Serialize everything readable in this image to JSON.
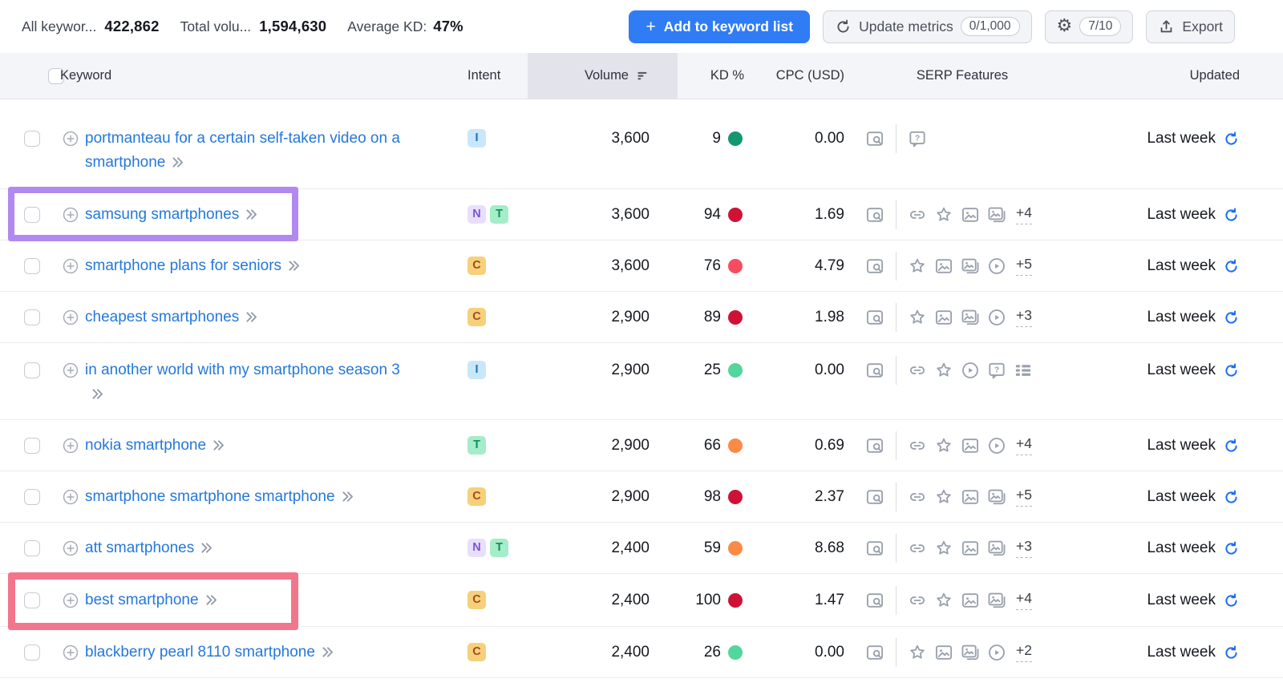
{
  "toolbar": {
    "stats": [
      {
        "label": "All keywor...",
        "value": "422,862"
      },
      {
        "label": "Total volu...",
        "value": "1,594,630"
      },
      {
        "label": "Average KD:",
        "value": "47%"
      }
    ],
    "add_button_plus": "+",
    "add_button_label": "Add to keyword list",
    "update_metrics_label": "Update metrics",
    "update_metrics_quota": "0/1,000",
    "settings_gear_glyph": "⚙",
    "settings_quota": "7/10",
    "export_label": "Export"
  },
  "table": {
    "headers": {
      "keyword": "Keyword",
      "intent": "Intent",
      "volume": "Volume",
      "kd": "KD %",
      "cpc": "CPC (USD)",
      "serp": "SERP Features",
      "updated": "Updated"
    },
    "rows": [
      {
        "keyword": "portmanteau for a certain self-taken video on a smartphone",
        "intents": [
          "I"
        ],
        "volume": "3,600",
        "kd": "9",
        "kd_color": "#13976F",
        "cpc": "0.00",
        "serp_features": [
          "faq"
        ],
        "serp_more": "",
        "updated": "Last week"
      },
      {
        "keyword": "samsung smartphones",
        "intents": [
          "N",
          "T"
        ],
        "volume": "3,600",
        "kd": "94",
        "kd_color": "#CE1236",
        "cpc": "1.69",
        "serp_features": [
          "link",
          "star",
          "image",
          "image-stack"
        ],
        "serp_more": "+4",
        "updated": "Last week"
      },
      {
        "keyword": "smartphone plans for seniors",
        "intents": [
          "C"
        ],
        "volume": "3,600",
        "kd": "76",
        "kd_color": "#F94B5F",
        "cpc": "4.79",
        "serp_features": [
          "star",
          "image",
          "image-stack",
          "video"
        ],
        "serp_more": "+5",
        "updated": "Last week"
      },
      {
        "keyword": "cheapest smartphones",
        "intents": [
          "C"
        ],
        "volume": "2,900",
        "kd": "89",
        "kd_color": "#CE1236",
        "cpc": "1.98",
        "serp_features": [
          "star",
          "image",
          "image-stack",
          "video"
        ],
        "serp_more": "+3",
        "updated": "Last week"
      },
      {
        "keyword": "in another world with my smartphone season 3",
        "intents": [
          "I"
        ],
        "volume": "2,900",
        "kd": "25",
        "kd_color": "#52D69B",
        "cpc": "0.00",
        "serp_features": [
          "link",
          "star",
          "video",
          "faq",
          "list"
        ],
        "serp_more": "",
        "updated": "Last week"
      },
      {
        "keyword": "nokia smartphone",
        "intents": [
          "T"
        ],
        "volume": "2,900",
        "kd": "66",
        "kd_color": "#FB8A46",
        "cpc": "0.69",
        "serp_features": [
          "link",
          "star",
          "image",
          "video"
        ],
        "serp_more": "+4",
        "updated": "Last week"
      },
      {
        "keyword": "smartphone smartphone smartphone",
        "intents": [
          "C"
        ],
        "volume": "2,900",
        "kd": "98",
        "kd_color": "#CE1236",
        "cpc": "2.37",
        "serp_features": [
          "link",
          "star",
          "image",
          "image-stack"
        ],
        "serp_more": "+5",
        "updated": "Last week"
      },
      {
        "keyword": "att smartphones",
        "intents": [
          "N",
          "T"
        ],
        "volume": "2,400",
        "kd": "59",
        "kd_color": "#FB8A46",
        "cpc": "8.68",
        "serp_features": [
          "link",
          "star",
          "image",
          "image-stack"
        ],
        "serp_more": "+3",
        "updated": "Last week"
      },
      {
        "keyword": "best smartphone",
        "intents": [
          "C"
        ],
        "volume": "2,400",
        "kd": "100",
        "kd_color": "#CE1236",
        "cpc": "1.47",
        "serp_features": [
          "link",
          "star",
          "image",
          "image-stack"
        ],
        "serp_more": "+4",
        "updated": "Last week"
      },
      {
        "keyword": "blackberry pearl 8110 smartphone",
        "intents": [
          "C"
        ],
        "volume": "2,400",
        "kd": "26",
        "kd_color": "#52D69B",
        "cpc": "0.00",
        "serp_features": [
          "star",
          "image",
          "image-stack",
          "video"
        ],
        "serp_more": "+2",
        "updated": "Last week"
      }
    ]
  },
  "colors": {
    "primary_blue": "#2F7CF5",
    "link_blue": "#2478DB",
    "refresh_blue": "#1C6EF2",
    "highlight_purple": "#B289F1",
    "highlight_pink": "#F3758C",
    "intent_colors": {
      "I": {
        "bg": "#C9E7FB",
        "fg": "#1F70BB",
        "name": "informational"
      },
      "N": {
        "bg": "#EADFFB",
        "fg": "#7A55D6",
        "name": "navigational"
      },
      "C": {
        "bg": "#F6D07A",
        "fg": "#A24B21",
        "name": "commercial"
      },
      "T": {
        "bg": "#A5ECC8",
        "fg": "#0F8F60",
        "name": "transactional"
      }
    }
  }
}
